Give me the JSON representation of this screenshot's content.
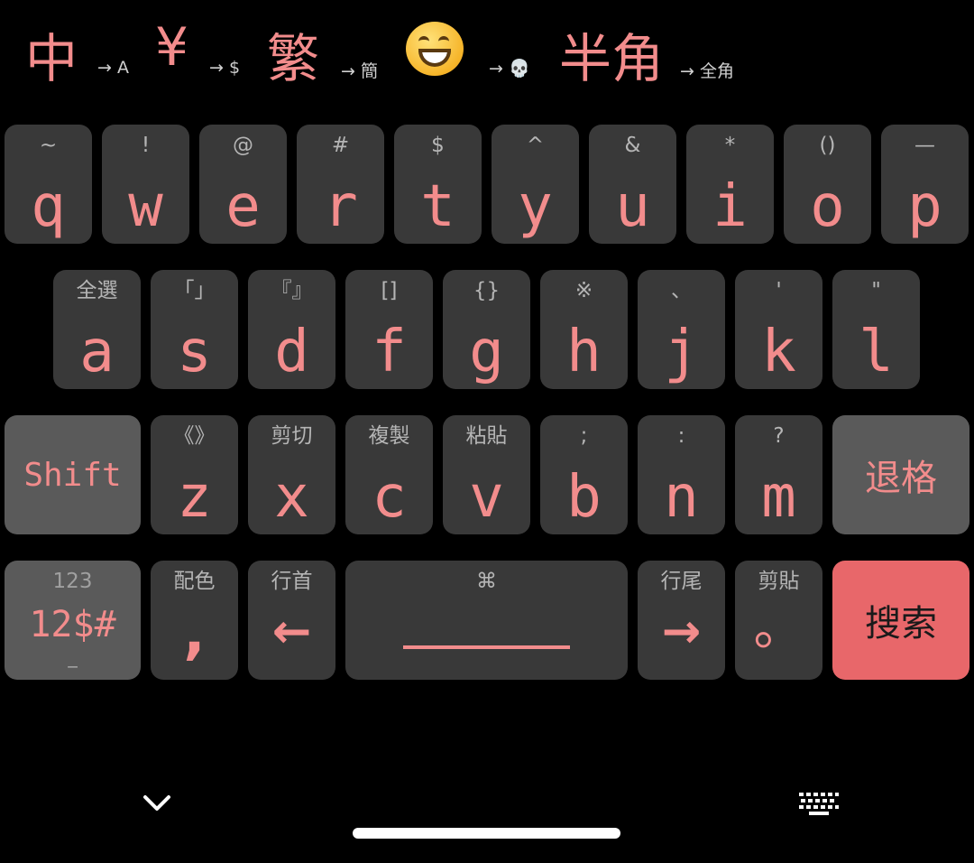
{
  "status": {
    "items": [
      {
        "big": "中",
        "small": "→ A"
      },
      {
        "big": "¥",
        "small": "→ $"
      },
      {
        "big": "繁",
        "small": "→ 簡"
      },
      {
        "big": "😄",
        "small": "→ 💀"
      },
      {
        "big": "半角",
        "small": "→ 全角"
      }
    ]
  },
  "keys": {
    "row1": [
      {
        "hint": "~",
        "label": "q"
      },
      {
        "hint": "!",
        "label": "w"
      },
      {
        "hint": "@",
        "label": "e"
      },
      {
        "hint": "#",
        "label": "r"
      },
      {
        "hint": "$",
        "label": "t"
      },
      {
        "hint": "^",
        "label": "y"
      },
      {
        "hint": "&",
        "label": "u"
      },
      {
        "hint": "*",
        "label": "i"
      },
      {
        "hint": "()",
        "label": "o"
      },
      {
        "hint": "—",
        "label": "p"
      }
    ],
    "row2": [
      {
        "hint": "全選",
        "label": "a"
      },
      {
        "hint": "「」",
        "label": "s"
      },
      {
        "hint": "『』",
        "label": "d"
      },
      {
        "hint": "[]",
        "label": "f"
      },
      {
        "hint": "{}",
        "label": "g"
      },
      {
        "hint": "※",
        "label": "h"
      },
      {
        "hint": "、",
        "label": "j"
      },
      {
        "hint": "'",
        "label": "k"
      },
      {
        "hint": "\"",
        "label": "l"
      }
    ],
    "row3": [
      {
        "hint": "《》",
        "label": "z"
      },
      {
        "hint": "剪切",
        "label": "x"
      },
      {
        "hint": "複製",
        "label": "c"
      },
      {
        "hint": "粘貼",
        "label": "v"
      },
      {
        "hint": ";",
        "label": "b"
      },
      {
        "hint": ":",
        "label": "n"
      },
      {
        "hint": "?",
        "label": "m"
      }
    ],
    "shift": "Shift",
    "backspace": "退格",
    "symbols": {
      "hint": "123",
      "label": "12$#",
      "sub": "—"
    },
    "color": {
      "hint": "配色",
      "label": ","
    },
    "home": {
      "hint": "行首",
      "label": "←"
    },
    "space": {
      "hint": "⌘"
    },
    "end": {
      "hint": "行尾",
      "label": "→"
    },
    "paste": {
      "hint": "剪貼",
      "label": "。"
    },
    "search": "搜索"
  },
  "nav": {
    "collapse_icon": "chevron-down-icon",
    "keyboard_icon": "keyboard-icon"
  },
  "colors": {
    "accent": "#e8676a",
    "label": "#f28c8c",
    "key": "#393939",
    "key_dark": "#5a5a5a"
  }
}
